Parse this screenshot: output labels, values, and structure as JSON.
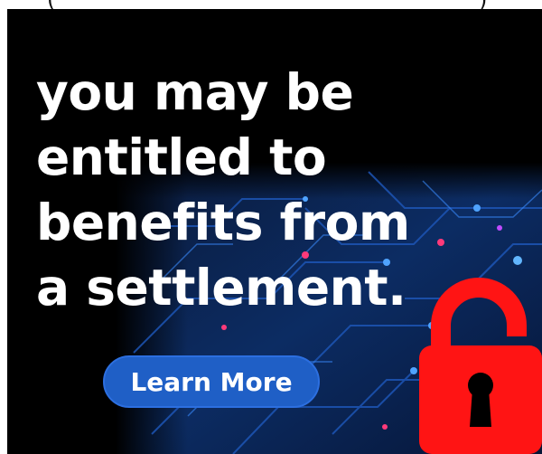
{
  "ad": {
    "headline_lines": [
      "you may be",
      "entitled to",
      "benefits from",
      "a settlement."
    ],
    "cta_label": "Learn More",
    "icon": "unlocked-padlock-icon",
    "colors": {
      "background": "#000000",
      "circuit": "#0d3f8f",
      "cta": "#1f5fc6",
      "lock": "#ff1414"
    }
  },
  "top_strip": {
    "left_glyph": "(",
    "right_glyph": ")"
  }
}
